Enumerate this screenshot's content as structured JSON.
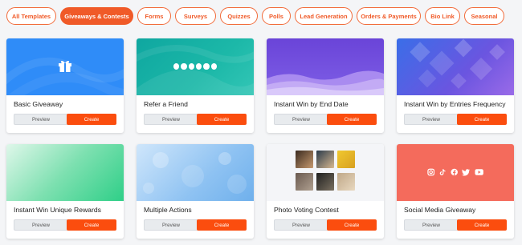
{
  "tabs": [
    {
      "label": "All Templates",
      "active": false
    },
    {
      "label": "Giveaways & Contests",
      "active": true
    },
    {
      "label": "Forms",
      "active": false
    },
    {
      "label": "Surveys",
      "active": false
    },
    {
      "label": "Quizzes",
      "active": false
    },
    {
      "label": "Polls",
      "active": false
    },
    {
      "label": "Lead Generation",
      "active": false
    },
    {
      "label": "Orders & Payments",
      "active": false
    },
    {
      "label": "Bio Link",
      "active": false
    },
    {
      "label": "Seasonal",
      "active": false
    }
  ],
  "buttons": {
    "preview": "Preview",
    "create": "Create"
  },
  "cards": [
    {
      "title": "Basic Giveaway",
      "thumbnail_icon": "gift-icon"
    },
    {
      "title": "Refer a Friend",
      "thumbnail_icon": "social-icons-row"
    },
    {
      "title": "Instant Win by End Date",
      "thumbnail_icon": "wave-pattern"
    },
    {
      "title": "Instant Win by Entries Frequency",
      "thumbnail_icon": "diamond-pattern"
    },
    {
      "title": "Instant Win Unique Rewards",
      "thumbnail_icon": "gradient"
    },
    {
      "title": "Multiple Actions",
      "thumbnail_icon": "bokeh-pattern"
    },
    {
      "title": "Photo Voting Contest",
      "thumbnail_icon": "photo-grid"
    },
    {
      "title": "Social Media Giveaway",
      "thumbnail_icon": "social-icons-row"
    }
  ],
  "colors": {
    "accent": "#f05a28",
    "create_button": "#fb4d0e"
  }
}
